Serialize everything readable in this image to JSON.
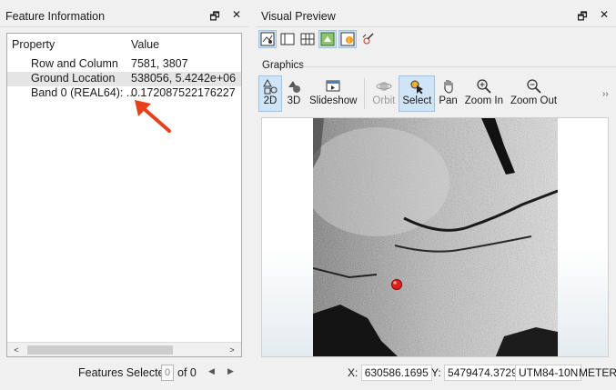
{
  "feature_info": {
    "title": "Feature Information",
    "header": {
      "property": "Property",
      "value": "Value"
    },
    "rows": [
      {
        "property": "Row and Column",
        "value": "7581, 3807"
      },
      {
        "property": "Ground Location",
        "value": "538056, 5.4242e+06"
      },
      {
        "property": "Band 0 (REAL64): ...",
        "value": "0.172087522176227"
      }
    ],
    "features_selected_label": "Features Selected:",
    "selected_count": "0",
    "of_total": "of 0"
  },
  "visual_preview": {
    "title": "Visual Preview",
    "graphics_label": "Graphics",
    "tools": [
      {
        "label": "2D",
        "icon": "2d-shapes-icon"
      },
      {
        "label": "3D",
        "icon": "3d-shapes-icon"
      },
      {
        "label": "Slideshow",
        "icon": "slideshow-icon"
      },
      {
        "label": "Orbit",
        "icon": "orbit-icon"
      },
      {
        "label": "Select",
        "icon": "select-icon"
      },
      {
        "label": "Pan",
        "icon": "hand-icon"
      },
      {
        "label": "Zoom In",
        "icon": "zoom-in-icon"
      },
      {
        "label": "Zoom Out",
        "icon": "zoom-out-icon"
      }
    ]
  },
  "status_bar": {
    "x_label": "X:",
    "x_value": "630586.1695",
    "y_label": "Y:",
    "y_value": "5479474.3729",
    "projection": "UTM84-10N",
    "units": "METER"
  },
  "colors": {
    "active_button": "#cfe4f7",
    "active_border": "#9ec3e6",
    "marker": "#e02020",
    "arrow": "#e8401c"
  }
}
